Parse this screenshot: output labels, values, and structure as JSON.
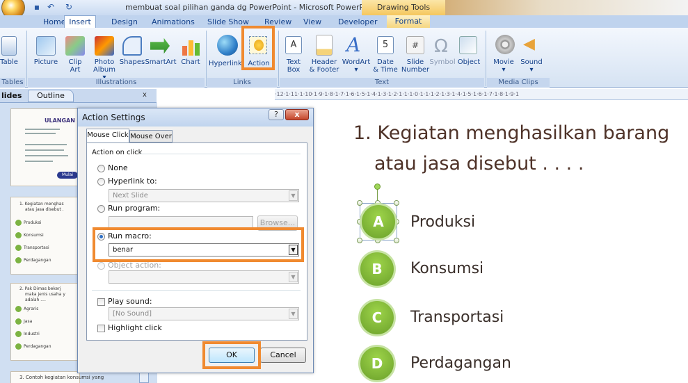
{
  "window": {
    "title": "membuat soal pilihan ganda dg PowerPoint - Microsoft PowerPoint",
    "contextual": "Drawing Tools"
  },
  "tabs": [
    "Home",
    "Insert",
    "Design",
    "Animations",
    "Slide Show",
    "Review",
    "View",
    "Developer",
    "Format"
  ],
  "ribbon": {
    "table_group": [
      "Table",
      "Tables"
    ],
    "illustrations": {
      "label": "Illustrations",
      "items": [
        [
          "Picture",
          ""
        ],
        [
          "Clip",
          "Art"
        ],
        [
          "Photo",
          "Album"
        ],
        [
          "Shapes",
          ""
        ],
        [
          "SmartArt",
          ""
        ],
        [
          "Chart",
          ""
        ]
      ]
    },
    "links": {
      "label": "Links",
      "items": [
        "Hyperlink",
        "Action"
      ]
    },
    "text": {
      "label": "Text",
      "items": [
        [
          "Text",
          "Box"
        ],
        [
          "Header",
          "& Footer"
        ],
        [
          "WordArt",
          ""
        ],
        [
          "Date",
          "& Time"
        ],
        [
          "Slide",
          "Number"
        ],
        [
          "Symbol",
          ""
        ],
        [
          "Object",
          ""
        ]
      ]
    },
    "media": {
      "label": "Media Clips",
      "items": [
        "Movie",
        "Sound"
      ]
    }
  },
  "pane": {
    "tab_slides": "lides",
    "tab_outline": "Outline",
    "close": "x"
  },
  "ruler": "·12·1·11·1·10·1·9·1·8·1·7·1·6·1·5·1·4·1·3·1·2·1·1·1·0·1·1·1·2·1·3·1·4·1·5·1·6·1·7·1·8·1·9·1",
  "thumbs": [
    {
      "num": "",
      "title": "ULANGAN",
      "button": "Mulai"
    },
    {
      "num": "",
      "lines": [
        "1. Kegiatan menghas",
        "atau jasa disebut ."
      ],
      "options": [
        "Produksi",
        "Konsumsi",
        "Transportasi",
        "Perdagangan"
      ]
    },
    {
      "num": "",
      "lines": [
        "2. Pak Dimas bekerj",
        "maka jenis usaha y",
        "adalah ...."
      ],
      "options": [
        "Agraris",
        "Jasa",
        "Industri",
        "Perdagangan"
      ]
    },
    {
      "num": "",
      "lines": [
        "3. Contoh kegiatan konsumsi yang"
      ]
    }
  ],
  "dialog": {
    "title": "Action Settings",
    "help": "?",
    "close": "x",
    "tab_click": "Mouse Click",
    "tab_over": "Mouse Over",
    "action_on_click": "Action on click",
    "none": "None",
    "hyperlink_to": "Hyperlink to:",
    "hyperlink_value": "Next Slide",
    "run_program": "Run program:",
    "browse": "Browse...",
    "run_macro": "Run macro:",
    "macro_value": "benar",
    "object_action": "Object action:",
    "play_sound": "Play sound:",
    "sound_value": "[No Sound]",
    "highlight_click": "Highlight click",
    "ok": "OK",
    "cancel": "Cancel"
  },
  "slide": {
    "question_line1": "1. Kegiatan menghasilkan barang",
    "question_line2": "atau jasa disebut . . . .",
    "options": [
      {
        "letter": "A",
        "text": "Produksi"
      },
      {
        "letter": "B",
        "text": "Konsumsi"
      },
      {
        "letter": "C",
        "text": "Transportasi"
      },
      {
        "letter": "D",
        "text": "Perdagangan"
      }
    ]
  },
  "colors": {
    "highlight": "#f08a30",
    "option_green": "#7cb342",
    "question_text": "#4e3228"
  }
}
